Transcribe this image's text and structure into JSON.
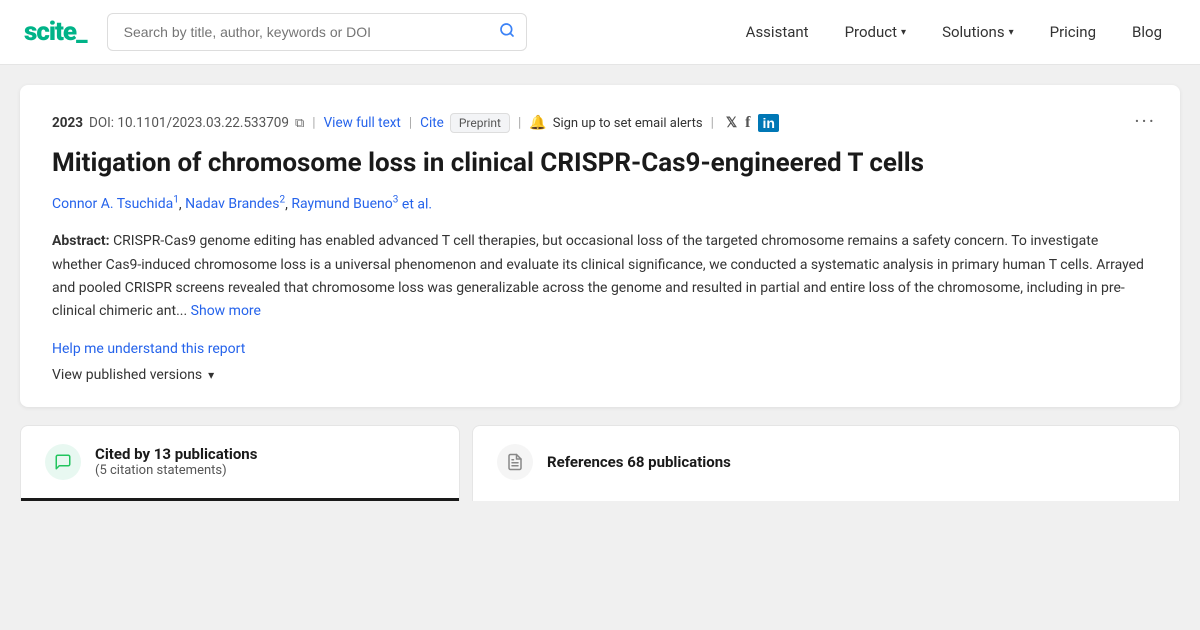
{
  "logo": {
    "text": "scite_",
    "accent": "scite"
  },
  "search": {
    "placeholder": "Search by title, author, keywords or DOI"
  },
  "nav": {
    "items": [
      {
        "label": "Assistant",
        "hasChevron": false
      },
      {
        "label": "Product",
        "hasChevron": true
      },
      {
        "label": "Solutions",
        "hasChevron": true
      },
      {
        "label": "Pricing",
        "hasChevron": false
      },
      {
        "label": "Blog",
        "hasChevron": false
      }
    ]
  },
  "paper": {
    "year": "2023",
    "doi": "DOI: 10.1101/2023.03.22.533709",
    "view_full_text": "View full text",
    "cite_label": "Cite",
    "preprint": "Preprint",
    "email_alert": "Sign up to set email alerts",
    "title": "Mitigation of chromosome loss in clinical CRISPR-Cas9-engineered T cells",
    "authors": [
      {
        "name": "Connor A. Tsuchida",
        "sup": "1"
      },
      {
        "name": "Nadav Brandes",
        "sup": "2"
      },
      {
        "name": "Raymund Bueno",
        "sup": "3"
      }
    ],
    "et_al": "et al.",
    "abstract_label": "Abstract:",
    "abstract_text": "CRISPR-Cas9 genome editing has enabled advanced T cell therapies, but occasional loss of the targeted chromosome remains a safety concern. To investigate whether Cas9-induced chromosome loss is a universal phenomenon and evaluate its clinical significance, we conducted a systematic analysis in primary human T cells. Arrayed and pooled CRISPR screens revealed that chromosome loss was generalizable across the genome and resulted in partial and entire loss of the chromosome, including in pre-clinical chimeric ant...",
    "show_more": "Show more",
    "help_link": "Help me understand this report",
    "published_versions": "View published versions"
  },
  "tabs": {
    "cited": {
      "main": "Cited by 13 publications",
      "sub": "(5 citation statements)"
    },
    "references": {
      "main": "References 68 publications"
    }
  },
  "icons": {
    "search": "🔍",
    "bell": "🔔",
    "twitter": "𝕏",
    "facebook": "f",
    "linkedin": "in",
    "more": "···",
    "copy": "⧉",
    "cited_bubble": "💬",
    "ref_doc": "📄",
    "chevron_down": "▾"
  }
}
